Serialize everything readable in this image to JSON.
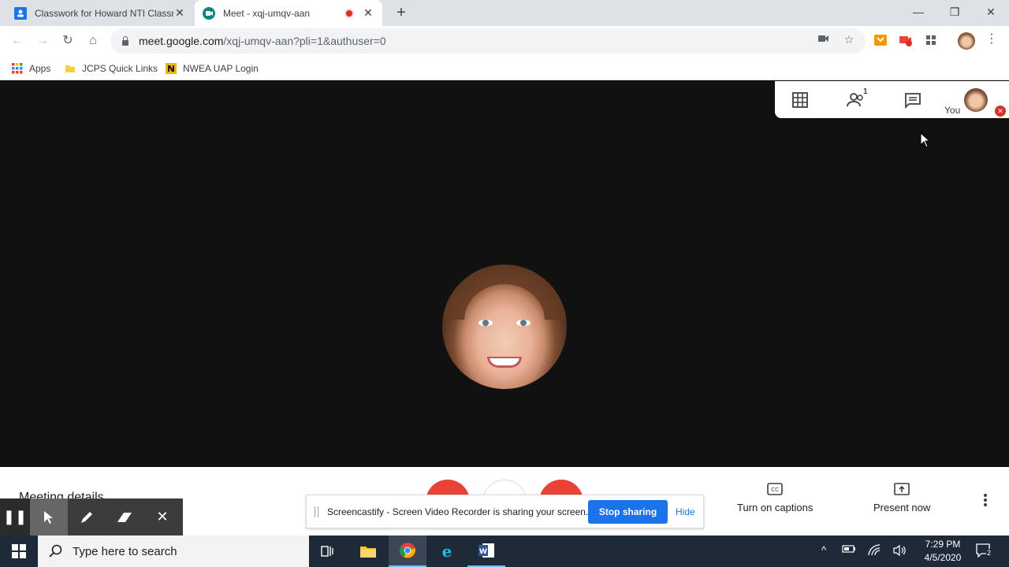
{
  "browser": {
    "tabs": [
      {
        "title": "Classwork for Howard NTI Classroom",
        "favicon_color": "#1a73e8"
      },
      {
        "title": "Meet - xqj-umqv-aan",
        "favicon_color": "#00897b",
        "recording": true
      }
    ],
    "url_host": "meet.google.com",
    "url_path": "/xqj-umqv-aan?pli=1&authuser=0",
    "bookmarks": [
      {
        "label": "Apps"
      },
      {
        "label": "JCPS Quick Links"
      },
      {
        "label": "NWEA UAP Login"
      }
    ]
  },
  "meet": {
    "top_panel": {
      "participants_count": "1",
      "self_label": "You"
    },
    "bottom": {
      "meeting_details_label": "Meeting details",
      "captions_label": "Turn on captions",
      "present_label": "Present now"
    },
    "share_notice": {
      "message": "Screencastify - Screen Video Recorder is sharing your screen.",
      "stop_label": "Stop sharing",
      "hide_label": "Hide"
    }
  },
  "taskbar": {
    "search_placeholder": "Type here to search",
    "time": "7:29 PM",
    "date": "4/5/2020",
    "notification_count": "2"
  },
  "colors": {
    "end_call": "#ea4335",
    "accent_blue": "#1a73e8"
  }
}
